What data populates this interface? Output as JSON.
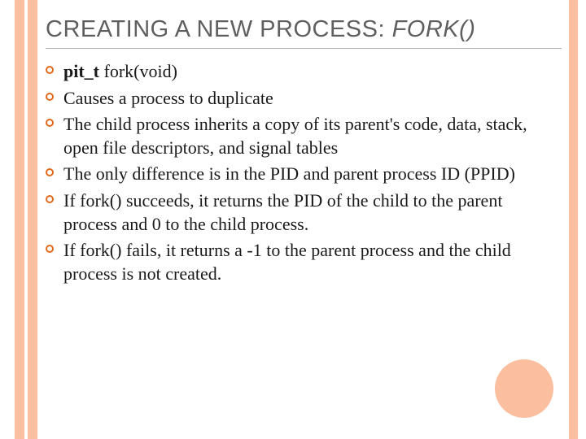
{
  "slide": {
    "title_plain": "CREATING A NEW PROCESS: ",
    "title_italic": "FORK()",
    "bullets": [
      {
        "bold": "pit_t",
        "rest": " fork(void)"
      },
      {
        "bold": "",
        "rest": "Causes a process to duplicate"
      },
      {
        "bold": "",
        "rest": "The child process inherits a copy of its parent's code, data, stack, open file descriptors, and signal tables"
      },
      {
        "bold": "",
        "rest": "The only difference is in the PID and parent process ID (PPID)"
      },
      {
        "bold": "",
        "rest": "If fork() succeeds, it returns the PID of the child to the parent process and 0 to the child process."
      },
      {
        "bold": "",
        "rest": "If fork() fails, it returns a -1 to the parent process and the child process is not created."
      }
    ]
  }
}
